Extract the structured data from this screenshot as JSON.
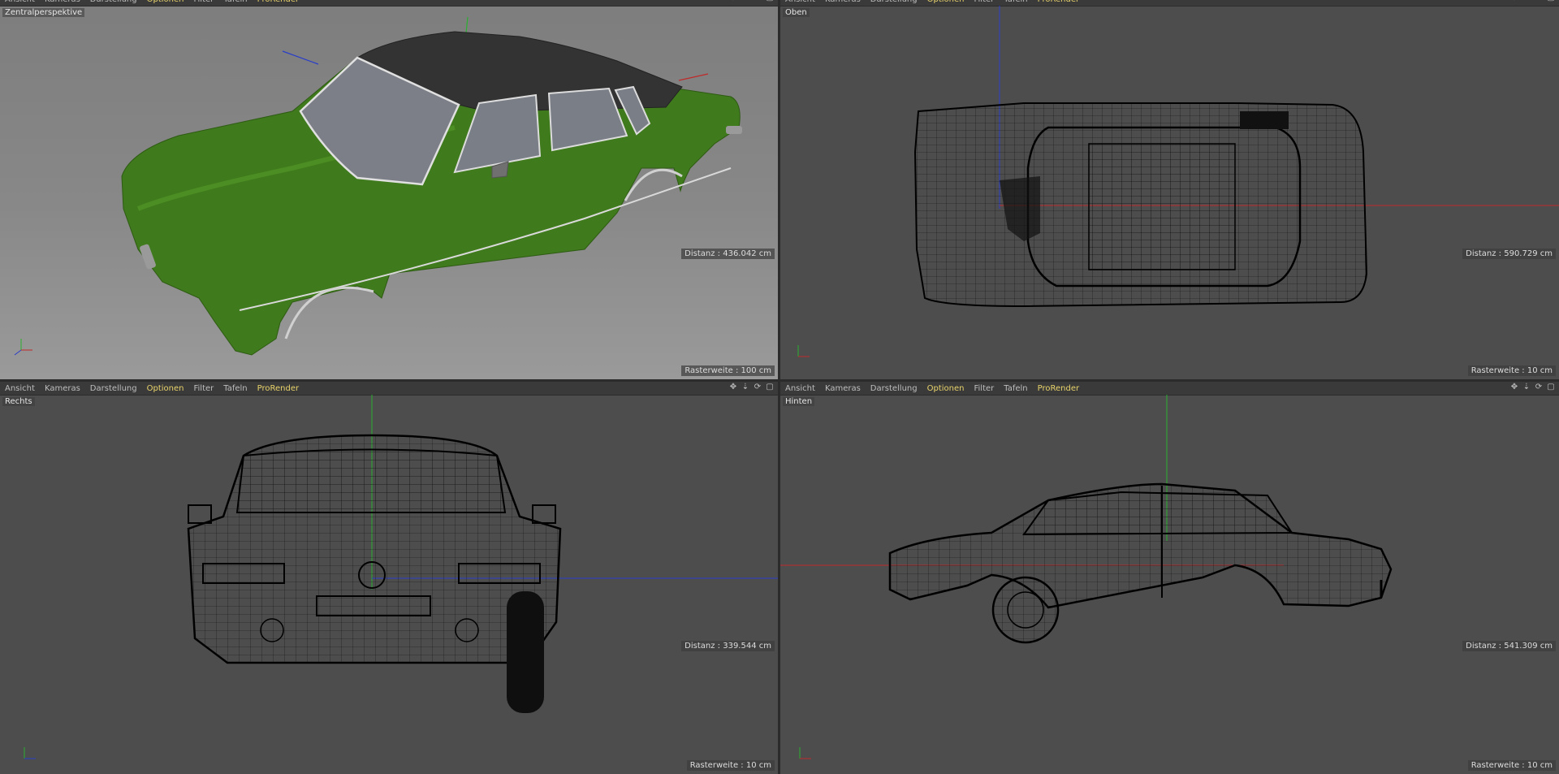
{
  "menu": [
    "Ansicht",
    "Kameras",
    "Darstellung",
    "Optionen",
    "Filter",
    "Tafeln",
    "ProRender"
  ],
  "menu_highlighted": [
    "Optionen",
    "ProRender"
  ],
  "tool_icons": [
    "move-view-icon",
    "zoom-view-icon",
    "rotate-view-icon",
    "maximize-view-icon"
  ],
  "axis_labels": {
    "x": "X",
    "y": "Y",
    "z": "Z"
  },
  "colors": {
    "viewport_bg": "#4d4d4d",
    "car_body": "#3f7a1c",
    "car_roof": "#333333",
    "axis_x": "#c02a2a",
    "axis_y": "#29b02f",
    "axis_z": "#2a3ec8",
    "menu_highlight": "#e8d36a"
  },
  "viewports": {
    "tl": {
      "name": "Zentralperspektive",
      "distanz": "Distanz : 436.042 cm",
      "raster": "Rasterweite : 100 cm"
    },
    "tr": {
      "name": "Oben",
      "distanz": "Distanz : 590.729 cm",
      "raster": "Rasterweite : 10 cm"
    },
    "bl": {
      "name": "Rechts",
      "distanz": "Distanz : 339.544 cm",
      "raster": "Rasterweite : 10 cm"
    },
    "br": {
      "name": "Hinten",
      "distanz": "Distanz : 541.309 cm",
      "raster": "Rasterweite : 10 cm"
    }
  }
}
